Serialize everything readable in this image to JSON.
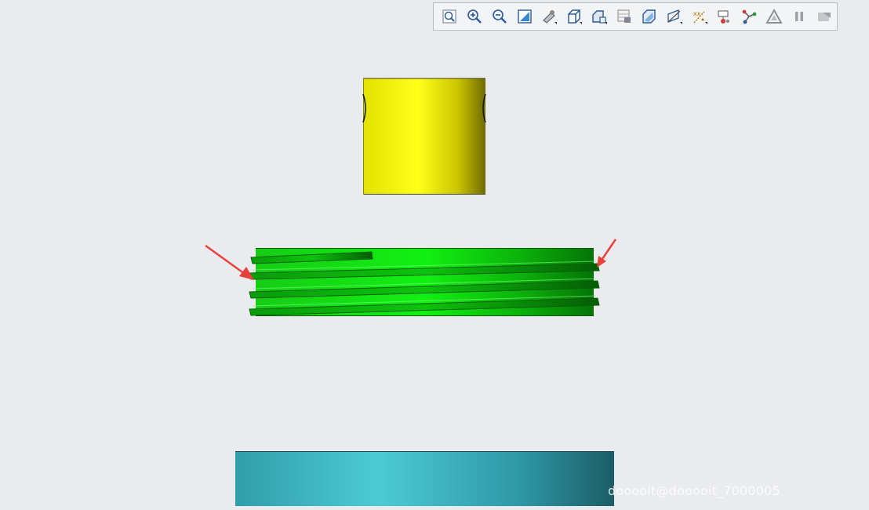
{
  "toolbar": {
    "buttons": [
      {
        "name": "refit-icon"
      },
      {
        "name": "zoom-in-icon"
      },
      {
        "name": "zoom-out-icon"
      },
      {
        "name": "repaint-icon"
      },
      {
        "name": "perspective-icon"
      },
      {
        "name": "display-style-icon"
      },
      {
        "name": "saved-orientations-icon"
      },
      {
        "name": "view-manager-icon"
      },
      {
        "name": "section-icon"
      },
      {
        "name": "datum-display-icon"
      },
      {
        "name": "annotation-display-icon"
      },
      {
        "name": "spin-center-icon"
      },
      {
        "name": "connection-icon"
      },
      {
        "name": "warning-triangle-icon"
      },
      {
        "name": "pause-icon"
      },
      {
        "name": "next-icon"
      }
    ]
  },
  "scene": {
    "parts": [
      {
        "name": "yellow-cylinder-part",
        "color": "#f4f000"
      },
      {
        "name": "green-threaded-part",
        "color": "#13d813"
      },
      {
        "name": "cyan-base-part",
        "color": "#3fb8c6"
      }
    ],
    "annotation_color": "#e8413c"
  },
  "watermark": "dooooit@dooooit_7000005"
}
